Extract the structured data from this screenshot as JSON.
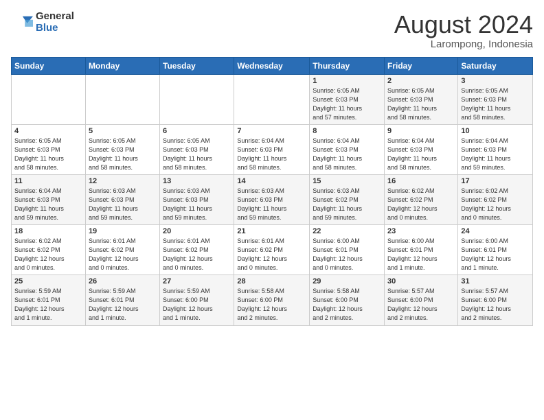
{
  "header": {
    "logo_general": "General",
    "logo_blue": "Blue",
    "month_title": "August 2024",
    "location": "Larompong, Indonesia"
  },
  "weekdays": [
    "Sunday",
    "Monday",
    "Tuesday",
    "Wednesday",
    "Thursday",
    "Friday",
    "Saturday"
  ],
  "weeks": [
    [
      {
        "day": "",
        "info": ""
      },
      {
        "day": "",
        "info": ""
      },
      {
        "day": "",
        "info": ""
      },
      {
        "day": "",
        "info": ""
      },
      {
        "day": "1",
        "info": "Sunrise: 6:05 AM\nSunset: 6:03 PM\nDaylight: 11 hours\nand 57 minutes."
      },
      {
        "day": "2",
        "info": "Sunrise: 6:05 AM\nSunset: 6:03 PM\nDaylight: 11 hours\nand 58 minutes."
      },
      {
        "day": "3",
        "info": "Sunrise: 6:05 AM\nSunset: 6:03 PM\nDaylight: 11 hours\nand 58 minutes."
      }
    ],
    [
      {
        "day": "4",
        "info": "Sunrise: 6:05 AM\nSunset: 6:03 PM\nDaylight: 11 hours\nand 58 minutes."
      },
      {
        "day": "5",
        "info": "Sunrise: 6:05 AM\nSunset: 6:03 PM\nDaylight: 11 hours\nand 58 minutes."
      },
      {
        "day": "6",
        "info": "Sunrise: 6:05 AM\nSunset: 6:03 PM\nDaylight: 11 hours\nand 58 minutes."
      },
      {
        "day": "7",
        "info": "Sunrise: 6:04 AM\nSunset: 6:03 PM\nDaylight: 11 hours\nand 58 minutes."
      },
      {
        "day": "8",
        "info": "Sunrise: 6:04 AM\nSunset: 6:03 PM\nDaylight: 11 hours\nand 58 minutes."
      },
      {
        "day": "9",
        "info": "Sunrise: 6:04 AM\nSunset: 6:03 PM\nDaylight: 11 hours\nand 58 minutes."
      },
      {
        "day": "10",
        "info": "Sunrise: 6:04 AM\nSunset: 6:03 PM\nDaylight: 11 hours\nand 59 minutes."
      }
    ],
    [
      {
        "day": "11",
        "info": "Sunrise: 6:04 AM\nSunset: 6:03 PM\nDaylight: 11 hours\nand 59 minutes."
      },
      {
        "day": "12",
        "info": "Sunrise: 6:03 AM\nSunset: 6:03 PM\nDaylight: 11 hours\nand 59 minutes."
      },
      {
        "day": "13",
        "info": "Sunrise: 6:03 AM\nSunset: 6:03 PM\nDaylight: 11 hours\nand 59 minutes."
      },
      {
        "day": "14",
        "info": "Sunrise: 6:03 AM\nSunset: 6:03 PM\nDaylight: 11 hours\nand 59 minutes."
      },
      {
        "day": "15",
        "info": "Sunrise: 6:03 AM\nSunset: 6:02 PM\nDaylight: 11 hours\nand 59 minutes."
      },
      {
        "day": "16",
        "info": "Sunrise: 6:02 AM\nSunset: 6:02 PM\nDaylight: 12 hours\nand 0 minutes."
      },
      {
        "day": "17",
        "info": "Sunrise: 6:02 AM\nSunset: 6:02 PM\nDaylight: 12 hours\nand 0 minutes."
      }
    ],
    [
      {
        "day": "18",
        "info": "Sunrise: 6:02 AM\nSunset: 6:02 PM\nDaylight: 12 hours\nand 0 minutes."
      },
      {
        "day": "19",
        "info": "Sunrise: 6:01 AM\nSunset: 6:02 PM\nDaylight: 12 hours\nand 0 minutes."
      },
      {
        "day": "20",
        "info": "Sunrise: 6:01 AM\nSunset: 6:02 PM\nDaylight: 12 hours\nand 0 minutes."
      },
      {
        "day": "21",
        "info": "Sunrise: 6:01 AM\nSunset: 6:02 PM\nDaylight: 12 hours\nand 0 minutes."
      },
      {
        "day": "22",
        "info": "Sunrise: 6:00 AM\nSunset: 6:01 PM\nDaylight: 12 hours\nand 0 minutes."
      },
      {
        "day": "23",
        "info": "Sunrise: 6:00 AM\nSunset: 6:01 PM\nDaylight: 12 hours\nand 1 minute."
      },
      {
        "day": "24",
        "info": "Sunrise: 6:00 AM\nSunset: 6:01 PM\nDaylight: 12 hours\nand 1 minute."
      }
    ],
    [
      {
        "day": "25",
        "info": "Sunrise: 5:59 AM\nSunset: 6:01 PM\nDaylight: 12 hours\nand 1 minute."
      },
      {
        "day": "26",
        "info": "Sunrise: 5:59 AM\nSunset: 6:01 PM\nDaylight: 12 hours\nand 1 minute."
      },
      {
        "day": "27",
        "info": "Sunrise: 5:59 AM\nSunset: 6:00 PM\nDaylight: 12 hours\nand 1 minute."
      },
      {
        "day": "28",
        "info": "Sunrise: 5:58 AM\nSunset: 6:00 PM\nDaylight: 12 hours\nand 2 minutes."
      },
      {
        "day": "29",
        "info": "Sunrise: 5:58 AM\nSunset: 6:00 PM\nDaylight: 12 hours\nand 2 minutes."
      },
      {
        "day": "30",
        "info": "Sunrise: 5:57 AM\nSunset: 6:00 PM\nDaylight: 12 hours\nand 2 minutes."
      },
      {
        "day": "31",
        "info": "Sunrise: 5:57 AM\nSunset: 6:00 PM\nDaylight: 12 hours\nand 2 minutes."
      }
    ]
  ]
}
